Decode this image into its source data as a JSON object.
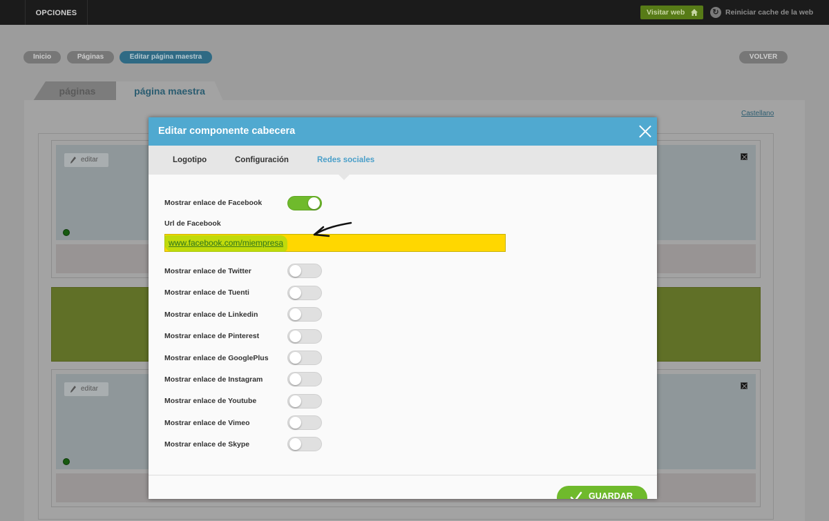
{
  "topbar": {
    "menu_label": "OPCIONES",
    "visit_label": "Visitar web",
    "reset_cache_label": "Reiniciar cache de la web"
  },
  "breadcrumb": {
    "items": [
      "Inicio",
      "Páginas",
      "Editar página maestra"
    ],
    "back_label": "VOLVER"
  },
  "page_tabs": {
    "pages": "páginas",
    "master": "página maestra"
  },
  "language_link": "Castellano",
  "blocks": {
    "edit_label": "editar"
  },
  "modal": {
    "title": "Editar componente cabecera",
    "tabs": [
      {
        "label": "Logotipo",
        "active": false
      },
      {
        "label": "Configuración",
        "active": false
      },
      {
        "label": "Redes sociales",
        "active": true
      }
    ],
    "facebook": {
      "label": "Mostrar enlace de Facebook",
      "enabled": true,
      "url_label": "Url de Facebook",
      "url_value": "www.facebook.com/miempresa"
    },
    "networks": [
      {
        "label": "Mostrar enlace de Twitter",
        "enabled": false
      },
      {
        "label": "Mostrar enlace de Tuenti",
        "enabled": false
      },
      {
        "label": "Mostrar enlace de Linkedin",
        "enabled": false
      },
      {
        "label": "Mostrar enlace de Pinterest",
        "enabled": false
      },
      {
        "label": "Mostrar enlace de GooglePlus",
        "enabled": false
      },
      {
        "label": "Mostrar enlace de Instagram",
        "enabled": false
      },
      {
        "label": "Mostrar enlace de Youtube",
        "enabled": false
      },
      {
        "label": "Mostrar enlace de Vimeo",
        "enabled": false
      },
      {
        "label": "Mostrar enlace de Skype",
        "enabled": false
      }
    ],
    "save_label": "GUARDAR"
  },
  "colors": {
    "header_blue": "#50a9d0",
    "tab_active": "#4a9fc9",
    "toggle_on": "#6fba2c",
    "url_field_highlight": "#ffd700",
    "save_green": "#6fba2c"
  },
  "icons": {
    "visit": "home-icon",
    "cache": "refresh-icon",
    "edit": "pencil-icon",
    "close": "close-icon",
    "save": "checkmark-icon",
    "annotation": "arrow-annotation-icon"
  }
}
